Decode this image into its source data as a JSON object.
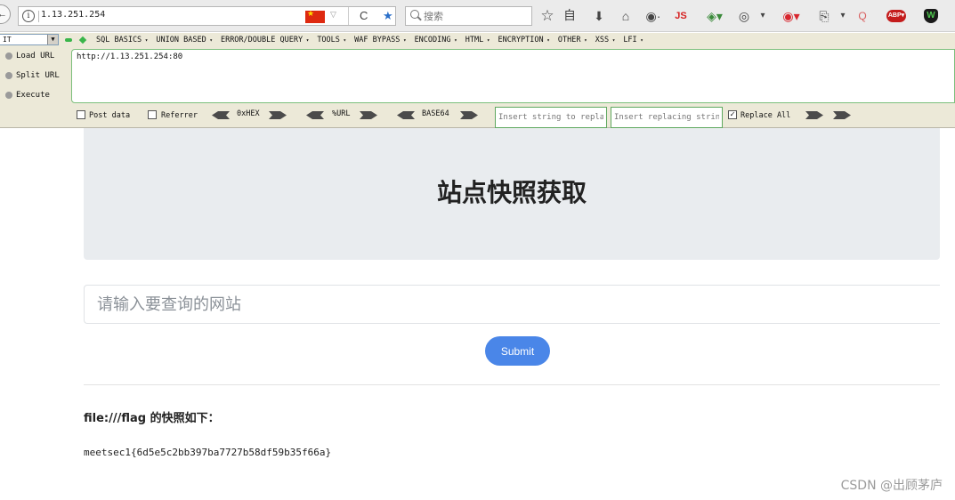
{
  "browser": {
    "back_glyph": "←",
    "url": "1.13.251.254",
    "search_placeholder": "搜索",
    "reload_glyph": "C",
    "icons": [
      "back-icon",
      "info-icon",
      "china-flag-icon",
      "reload-icon",
      "bookmark-star-icon",
      "bookmarks-list-icon",
      "download-icon",
      "home-icon",
      "globe-icon",
      "js-icon",
      "addon-icon",
      "palette-icon",
      "fire-icon",
      "clipboard-icon",
      "zoom-icon",
      "adblock-icon",
      "shield-icon"
    ],
    "toolbar": {
      "star": "☆",
      "list": "自",
      "download": "⬇",
      "home": "⌂",
      "globe": "◉·",
      "js": "JS",
      "addon": "◈▾",
      "palette": "◎",
      "dropdown1": "▾",
      "fire": "◉▾",
      "clipboard": "⎘",
      "dropdown2": "▾",
      "zoom": "Q",
      "abp": "ABP▾",
      "shield": "W"
    }
  },
  "hackbar": {
    "select_value": "IT",
    "menu": [
      "SQL BASICS",
      "UNION BASED",
      "ERROR/DOUBLE QUERY",
      "TOOLS",
      "WAF BYPASS",
      "ENCODING",
      "HTML",
      "ENCRYPTION",
      "OTHER",
      "XSS",
      "LFI"
    ],
    "actions": {
      "load": "Load URL",
      "split": "Split URL",
      "execute": "Execute"
    },
    "url_value": "http://1.13.251.254:80",
    "post_data_label": "Post data",
    "referrer_label": "Referrer",
    "hex_label": "0xHEX",
    "url_enc_label": "%URL",
    "base64_label": "BASE64",
    "replace_placeholder": "Insert string to replace",
    "replacing_placeholder": "Insert replacing string",
    "replace_all_label": "Replace All",
    "replace_all_checked": true
  },
  "page": {
    "title": "站点快照获取",
    "input_placeholder": "请输入要查询的网站",
    "submit_label": "Submit",
    "result_heading": "file:///flag 的快照如下：",
    "result_content": "meetsec1{6d5e5c2bb397ba7727b58df59b35f66a}",
    "accent_color": "#4a86e8"
  },
  "watermark": "CSDN @出顾茅庐"
}
